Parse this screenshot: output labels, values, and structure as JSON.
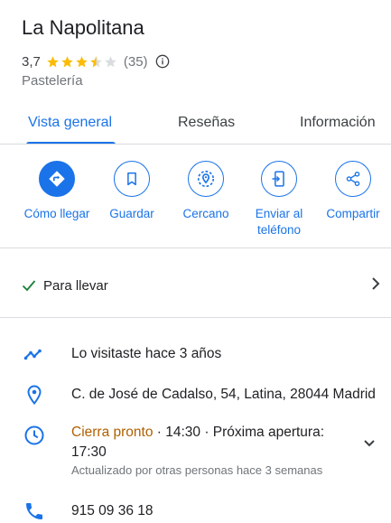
{
  "place": {
    "name": "La Napolitana",
    "rating": "3,7",
    "stars": 3.7,
    "review_count": "(35)",
    "category": "Pastelería"
  },
  "tabs": [
    {
      "label": "Vista general",
      "active": true
    },
    {
      "label": "Reseñas",
      "active": false
    },
    {
      "label": "Información",
      "active": false
    }
  ],
  "actions": {
    "directions": {
      "label": "Cómo llegar",
      "icon": "directions-icon"
    },
    "save": {
      "label": "Guardar",
      "icon": "bookmark-icon"
    },
    "nearby": {
      "label": "Cercano",
      "icon": "nearby-icon"
    },
    "send_to_phone": {
      "label_line1": "Enviar al",
      "label_line2": "teléfono",
      "icon": "send-to-phone-icon"
    },
    "share": {
      "label": "Compartir",
      "icon": "share-icon"
    }
  },
  "service_options": {
    "takeaway": "Para llevar"
  },
  "details": {
    "visited": "Lo visitaste hace 3 años",
    "address": "C. de José de Cadalso, 54, Latina, 28044 Madrid",
    "hours_status": "Cierra pronto",
    "hours_detail": " · 14:30 · Próxima apertura:",
    "hours_next": "17:30",
    "hours_updated": "Actualizado por otras personas hace 3 semanas",
    "phone": "915 09 36 18"
  },
  "colors": {
    "accent": "#1a73e8",
    "star": "#fbbc04",
    "hours_warning": "#b06000",
    "check": "#188038"
  }
}
